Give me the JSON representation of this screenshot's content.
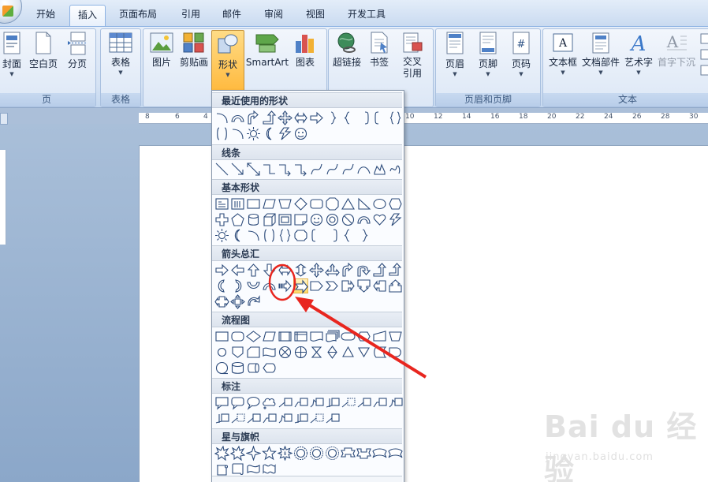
{
  "tabs": {
    "home": "开始",
    "insert": "插入",
    "page_layout": "页面布局",
    "references": "引用",
    "mailings": "邮件",
    "review": "审阅",
    "view": "视图",
    "developer": "开发工具"
  },
  "ribbon": {
    "pages_group": {
      "label": "页",
      "cover": "封面",
      "blank_page": "空白页",
      "page_break": "分页"
    },
    "table_group": {
      "label": "表格",
      "table": "表格"
    },
    "illustrations_group": {
      "picture": "图片",
      "clipart": "剪贴画",
      "shapes": "形状",
      "smartart": "SmartArt",
      "chart": "图表"
    },
    "links_group": {
      "hyperlink": "超链接",
      "bookmark": "书签",
      "cross_ref_line1": "交叉",
      "cross_ref_line2": "引用"
    },
    "header_footer_group": {
      "label": "页眉和页脚",
      "header": "页眉",
      "footer": "页脚",
      "page_number": "页码"
    },
    "text_group": {
      "label": "文本",
      "text_box": "文本框",
      "quick_parts": "文档部件",
      "wordart": "艺术字",
      "drop_cap": "首字下沉"
    }
  },
  "shapes_menu": {
    "sections": {
      "recent": "最近使用的形状",
      "lines": "线条",
      "basic": "基本形状",
      "arrows": "箭头总汇",
      "flowchart": "流程图",
      "callouts": "标注",
      "stars": "星与旗帜"
    },
    "highlighted_shape": "notched-right-arrow-icon"
  },
  "ruler": {
    "ticks": [
      "8",
      "6",
      "4",
      "10",
      "12",
      "14",
      "16",
      "18",
      "20",
      "22",
      "24",
      "26",
      "28",
      "30"
    ]
  },
  "watermark": {
    "logo": "Bai du 经验",
    "site": "jingyan.baidu.com"
  },
  "colors": {
    "ribbon_bg": "#d6e3f4",
    "pressed_button": "#ffb93d",
    "annotation_red": "#e8261f",
    "doc_background": "#8ba7c9"
  }
}
